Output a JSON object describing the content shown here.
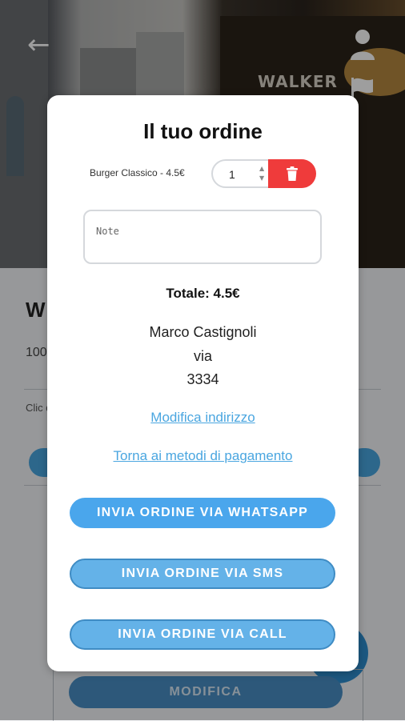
{
  "background": {
    "store_sign": "WALKER",
    "title_partial": "W",
    "meta_partial": "100",
    "desc_partial": "Clic disa",
    "modify_button_label": "MODIFICA"
  },
  "modal": {
    "title": "Il tuo ordine",
    "item": {
      "label": "Burger Classico - 4.5€",
      "quantity": "1"
    },
    "notes_placeholder": "Note",
    "total": "Totale: 4.5€",
    "address": {
      "name": "Marco Castignoli",
      "street": "via",
      "number": "3334"
    },
    "links": {
      "edit_address": "Modifica indirizzo",
      "back_to_payment": "Torna ai metodi di pagamento"
    },
    "buttons": {
      "whatsapp": "INVIA ORDINE VIA WHATSAPP",
      "sms": "INVIA ORDINE VIA SMS",
      "call": "INVIA ORDINE VIA CALL"
    }
  },
  "colors": {
    "accent": "#4aa6ec",
    "delete": "#ef3b3b",
    "link": "#4aa6e0"
  },
  "icons": [
    "back-arrow-icon",
    "user-icon",
    "flag-icon",
    "trash-icon"
  ]
}
